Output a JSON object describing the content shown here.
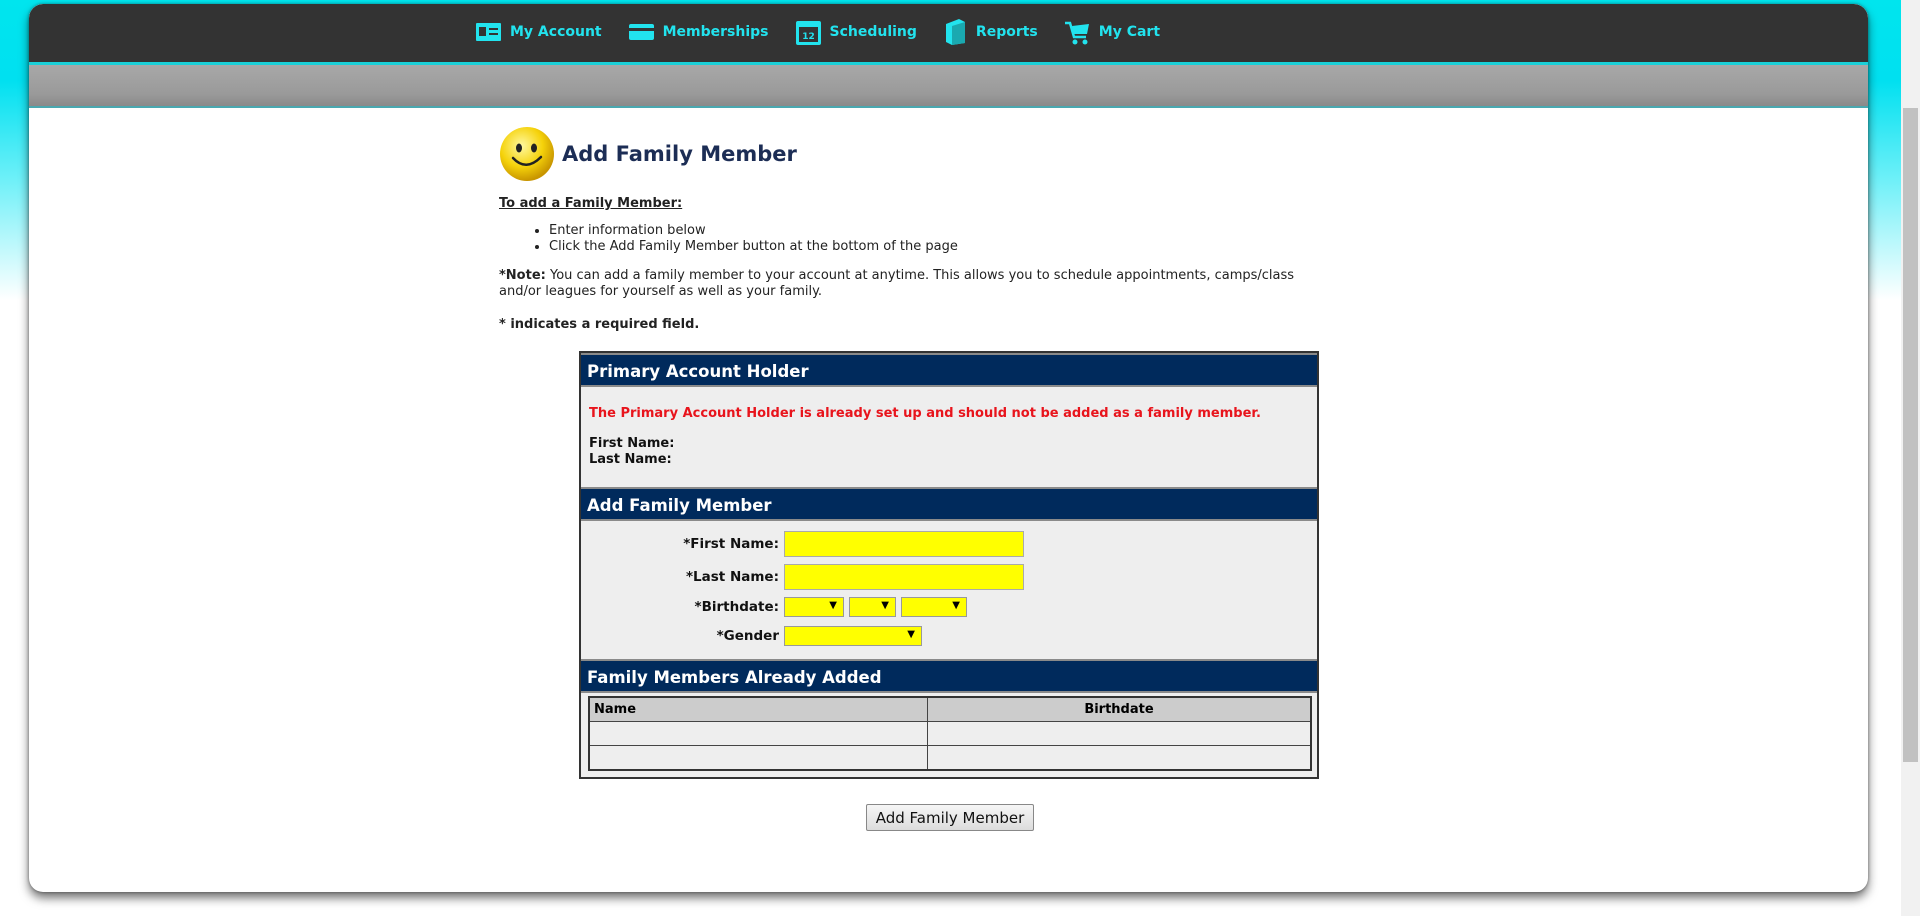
{
  "nav": {
    "items": [
      {
        "label": "My Account",
        "icon": "id-card-icon"
      },
      {
        "label": "Memberships",
        "icon": "card-icon"
      },
      {
        "label": "Scheduling",
        "icon": "calendar-icon"
      },
      {
        "label": "Reports",
        "icon": "book-icon"
      },
      {
        "label": "My Cart",
        "icon": "cart-icon"
      }
    ],
    "calendar_day": "12"
  },
  "page": {
    "title": "Add Family Member",
    "instructions_title": "To add a Family Member:",
    "instructions": [
      "Enter information below",
      "Click the Add Family Member button at the bottom of the page"
    ],
    "note_label": "*Note:",
    "note_text": " You can add a family member to your account at anytime. This allows you to schedule appointments, camps/class and/or leagues for yourself as well as your family.",
    "required_text": "* indicates a required field."
  },
  "primary": {
    "header": "Primary Account Holder",
    "warning": "The Primary Account Holder is already set up and should not be added as a family member.",
    "first_name_label": "First Name:",
    "last_name_label": "Last Name:"
  },
  "add_member": {
    "header": "Add Family Member",
    "first_name_label": "*First Name:",
    "last_name_label": "*Last Name:",
    "birthdate_label": "*Birthdate:",
    "gender_label": "*Gender",
    "first_name_value": "",
    "last_name_value": ""
  },
  "family_list": {
    "header": "Family Members Already Added",
    "columns": [
      "Name",
      "Birthdate"
    ]
  },
  "submit_label": "Add Family Member",
  "colors": {
    "accent": "#22e3ee",
    "section_header": "#002a5c",
    "required_field": "#ffff00",
    "warning": "#e8141c"
  }
}
